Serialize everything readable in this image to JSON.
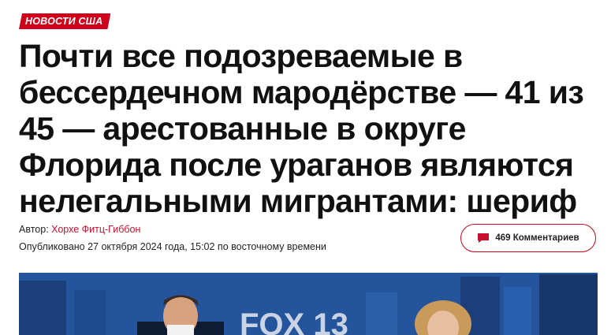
{
  "category": "НОВОСТИ США",
  "headline": "Почти все подозреваемые в бессердечном мародёрстве — 41 из 45 — арестованные в округе Флорида после ураганов являются нелегальными мигрантами: шериф",
  "byline": {
    "label": "Автор:",
    "author": "Хорхе Фитц-Гиббон",
    "published": "Опубликовано 27 октября 2024 года, 15:02 по восточному времени"
  },
  "comments": {
    "label": "469 Комментариев",
    "icon": "comment-icon"
  },
  "hero": {
    "logo_text": "FOX 13"
  },
  "colors": {
    "accent": "#d0021b",
    "link": "#c8102e"
  }
}
